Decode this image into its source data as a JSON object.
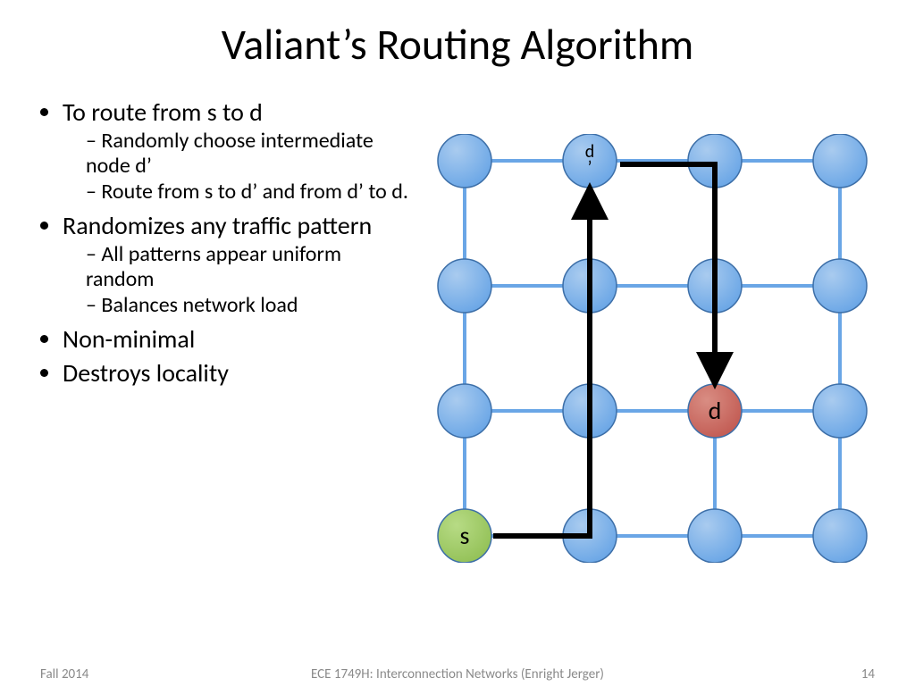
{
  "title": "Valiant’s Routing Algorithm",
  "bullets": {
    "b1": "To route from s to d",
    "b1a": "Randomly choose intermediate node d’",
    "b1b": "Route from s to d’ and from d’ to d.",
    "b2": "Randomizes any traffic pattern",
    "b2a": "All patterns appear uniform random",
    "b2b": "Balances network load",
    "b3": "Non-minimal",
    "b4": "Destroys locality"
  },
  "labels": {
    "s": "s",
    "d": "d",
    "dprime": "d’"
  },
  "footer": {
    "left": "Fall 2014",
    "center": "ECE 1749H: Interconnection Networks (Enright Jerger)",
    "right": "14"
  },
  "diagram": {
    "grid_size": 4,
    "source_node": [
      0,
      3
    ],
    "intermediate_node": [
      1,
      0
    ],
    "destination_node": [
      2,
      2
    ],
    "colors": {
      "default_node": "#6aa6e6",
      "source_node": "#93c157",
      "destination_node": "#c25b53",
      "edge": "#6aa6e6",
      "arrow": "#000000"
    }
  }
}
